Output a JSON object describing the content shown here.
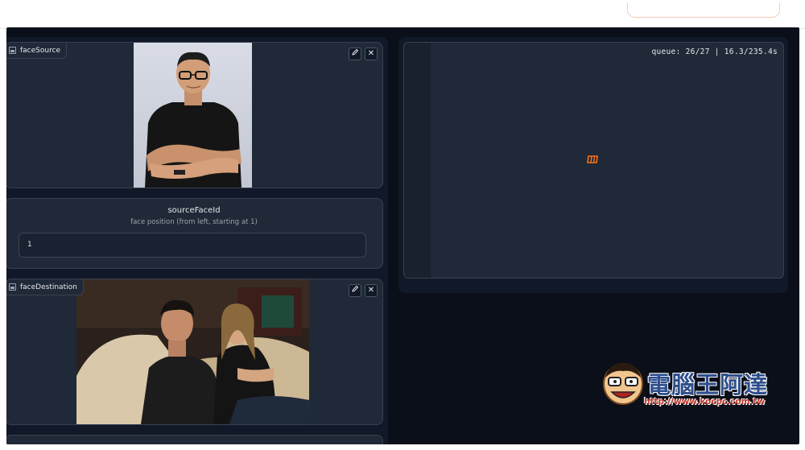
{
  "blocks": {
    "face_source": {
      "label": "faceSource"
    },
    "source_face_id": {
      "title": "sourceFaceId",
      "subtitle": "face position (from left, starting at 1)",
      "value": "1"
    },
    "face_destination": {
      "label": "faceDestination"
    }
  },
  "tools": {
    "edit_icon": "pencil-icon",
    "close_icon": "close-icon",
    "close_glyph": "✕"
  },
  "output": {
    "queue_status": "queue: 26/27 | 16.3/235.4s"
  },
  "watermark": {
    "text": "電腦王阿達",
    "url": "http://www.kocpc.com.tw"
  },
  "colors": {
    "bg": "#0b0f19",
    "panel": "#1f2937",
    "border": "#374151",
    "accent": "#f97316"
  }
}
